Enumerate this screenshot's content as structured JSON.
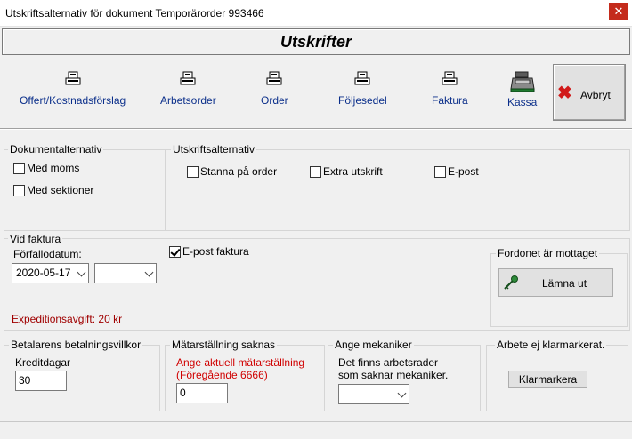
{
  "window": {
    "title": "Utskriftsalternativ för dokument  Temporärorder 993466",
    "close_glyph": "✕"
  },
  "banner": {
    "title": "Utskrifter"
  },
  "toolbar": {
    "offert": "Offert/Kostnadsförslag",
    "arbetsorder": "Arbetsorder",
    "order": "Order",
    "foljesedel": "Följesedel",
    "faktura": "Faktura",
    "kassa": "Kassa",
    "avbryt": "Avbryt"
  },
  "dokumentalternativ": {
    "title": "Dokumentalternativ",
    "med_moms": {
      "label": "Med moms",
      "checked": false
    },
    "med_sektioner": {
      "label": "Med sektioner",
      "checked": false
    }
  },
  "utskriftsalternativ": {
    "title": "Utskriftsalternativ",
    "stanna_pa_order": {
      "label": "Stanna på order",
      "checked": false
    },
    "extra_utskrift": {
      "label": "Extra utskrift",
      "checked": false
    },
    "epost": {
      "label": "E-post",
      "checked": false
    }
  },
  "vid_faktura": {
    "title": "Vid faktura",
    "forfallodatum_label": "Förfallodatum:",
    "date_value": "2020-05-17",
    "second_combo_value": "",
    "epost_faktura": {
      "label": "E-post faktura",
      "checked": true
    },
    "expeditionsavgift": "Expeditionsavgift: 20 kr"
  },
  "fordonet": {
    "title": "Fordonet är mottaget",
    "lamna_ut": "Lämna ut"
  },
  "betalare": {
    "title": "Betalarens betalningsvillkor",
    "kreditdagar_label": "Kreditdagar",
    "kreditdagar_value": "30"
  },
  "matarstallning": {
    "title": "Mätarställning saknas",
    "warning_line1": "Ange aktuell mätarställning",
    "warning_line2": "(Föregående 6666)",
    "value": "0"
  },
  "mekaniker": {
    "title": "Ange mekaniker",
    "info_line1": "Det finns arbetsrader",
    "info_line2": "som saknar mekaniker.",
    "combo_value": ""
  },
  "klarmarkering": {
    "title": "Arbete ej klarmarkerat.",
    "button": "Klarmarkera"
  },
  "colors": {
    "link_blue": "#0a2e8a",
    "warning_red": "#d00000",
    "fee_red": "#a00000",
    "close_red": "#c42b1c"
  }
}
